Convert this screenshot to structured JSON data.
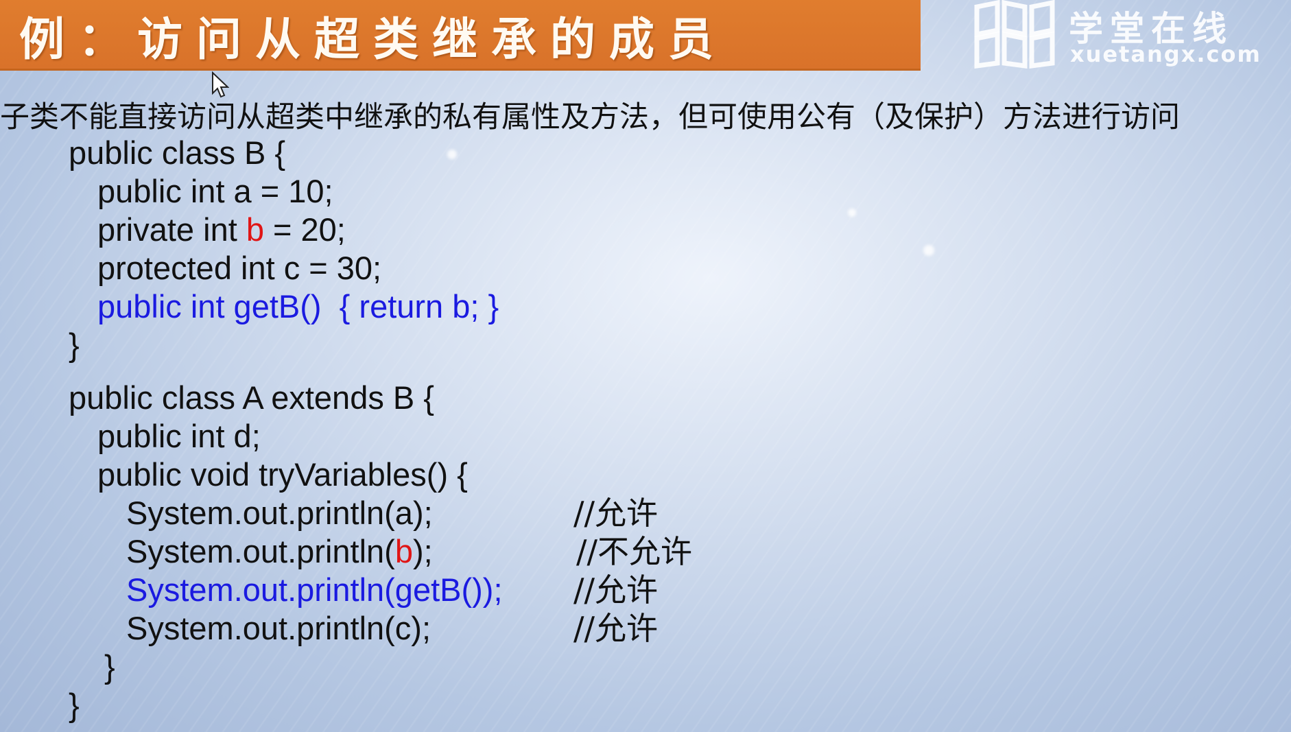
{
  "title": "例：访问从超类继承的成员",
  "logo": {
    "name_cn": "学堂在线",
    "name_en": "xuetangx.com"
  },
  "subtitle": "子类不能直接访问从超类中继承的私有属性及方法，但可使用公有（及保护）方法进行访问",
  "code": {
    "class_b_header": "public class B {",
    "field_a": "public int a = 10;",
    "field_b_prefix": "private int ",
    "field_b_var": "b",
    "field_b_suffix": " = 20;",
    "field_c": "protected int c = 30;",
    "method_getb": "public int getB()  { return b; }",
    "class_b_close": "}",
    "class_a_header": "public class A extends B {",
    "field_d": "public int d;",
    "method_try": "public void tryVariables() {",
    "print_a": "System.out.println(a);",
    "print_b_prefix": "System.out.println(",
    "print_b_var": "b",
    "print_b_suffix": ");",
    "print_getb": "System.out.println(getB());",
    "print_c": "System.out.println(c);",
    "method_close": "}",
    "class_a_close": "}"
  },
  "comments": {
    "allow_a": "//允许",
    "deny_b": "//不允许",
    "allow_getb": "//允许",
    "allow_c": "//允许"
  },
  "colors": {
    "title_bar": "#dd7a2d",
    "highlight_blue": "#1a1ae0",
    "highlight_red": "#e01515"
  }
}
